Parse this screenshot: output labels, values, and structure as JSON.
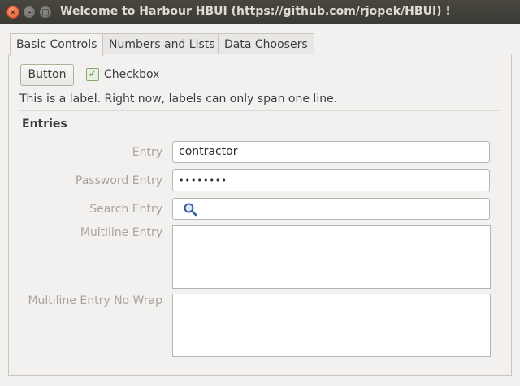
{
  "window": {
    "title": "Welcome to Harbour HBUI (https://github.com/rjopek/HBUI) !",
    "close_glyph": "×",
    "minimize_glyph": "–",
    "maximize_glyph": "□"
  },
  "tabs": [
    {
      "label": "Basic Controls",
      "active": true
    },
    {
      "label": "Numbers and Lists",
      "active": false
    },
    {
      "label": "Data Choosers",
      "active": false
    }
  ],
  "basic": {
    "button_label": "Button",
    "checkbox_label": "Checkbox",
    "checkbox_checked": true,
    "checkbox_glyph": "✓",
    "info_label": "This is a label. Right now, labels can only span one line."
  },
  "entries": {
    "section_title": "Entries",
    "entry_label": "Entry",
    "entry_value": "contractor",
    "password_label": "Password Entry",
    "password_value": "••••••••",
    "search_label": "Search Entry",
    "search_value": "",
    "search_icon": "search-icon",
    "multiline_label": "Multiline Entry",
    "multiline_value": "",
    "multiline_nowrap_label": "Multiline Entry No Wrap",
    "multiline_nowrap_value": ""
  }
}
